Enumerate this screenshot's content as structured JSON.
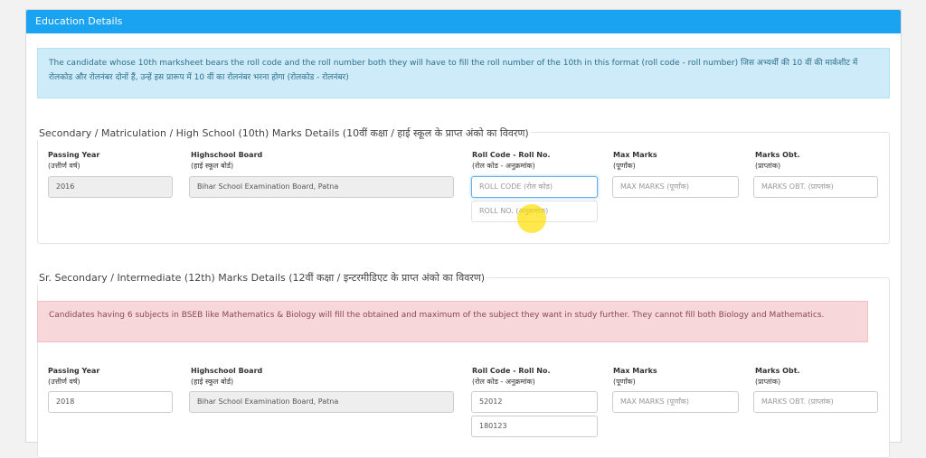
{
  "panel": {
    "title": "Education Details",
    "info_text": "The candidate whose 10th marksheet bears the roll code and the roll number both they will have to fill the roll number of the 10th in this format (roll code - roll number) जिस अभ्यर्थी की 10 वीं की मार्कशीट में रोलकोड और रोलनंबर दोनों हैं, उन्हें इस प्रारूप में 10 वीं का रोलनंबर भरना होगा (रोलकोड - रोलनंबर)"
  },
  "secondary": {
    "title": "Secondary / Matriculation / High School (10th) Marks Details (10वीं कक्षा / हाई स्कूल के प्राप्त अंको का विवरण)",
    "labels": {
      "passing_year": "Passing Year",
      "passing_year_hi": "(उत्तीर्ण वर्ष)",
      "board": "Highschool Board",
      "board_hi": "(हाई स्कूल बोर्ड)",
      "roll": "Roll Code - Roll No.",
      "roll_hi": "(रोल कोड - अनुक्रमांक)",
      "max": "Max Marks",
      "max_hi": "(पूर्णांक)",
      "obt": "Marks Obt.",
      "obt_hi": "(प्राप्तांक)"
    },
    "values": {
      "passing_year": "2016",
      "board": "Bihar School Examination Board, Patna"
    },
    "placeholders": {
      "roll_code": "ROLL CODE (रोल कोड)",
      "roll_no": "ROLL NO. (अनुक्रमांक)",
      "max": "MAX MARKS (पूर्णांक)",
      "obt": "MARKS OBT. (प्राप्तांक)"
    }
  },
  "senior": {
    "title": "Sr. Secondary / Intermediate (12th) Marks Details (12वीं कक्षा / इन्टरमीडिएट के प्राप्त अंको का विवरण)",
    "alert_text": "Candidates having 6 subjects in BSEB like Mathematics & Biology will fill the obtained and maximum of the subject they want in study further. They cannot fill both Biology and Mathematics.",
    "labels": {
      "passing_year": "Passing Year",
      "passing_year_hi": "(उत्तीर्ण वर्ष)",
      "board": "Highschool Board",
      "board_hi": "(हाई स्कूल बोर्ड)",
      "roll": "Roll Code - Roll No.",
      "roll_hi": "(रोल कोड - अनुक्रमांक)",
      "max": "Max Marks",
      "max_hi": "(पूर्णांक)",
      "obt": "Marks Obt.",
      "obt_hi": "(प्राप्तांक)"
    },
    "values": {
      "passing_year": "2018",
      "board": "Bihar School Examination Board, Patna",
      "roll_code": "52012",
      "roll_no": "180123"
    },
    "placeholders": {
      "max": "MAX MARKS (पूर्णांक)",
      "obt": "MARKS OBT. (प्राप्तांक)"
    }
  }
}
